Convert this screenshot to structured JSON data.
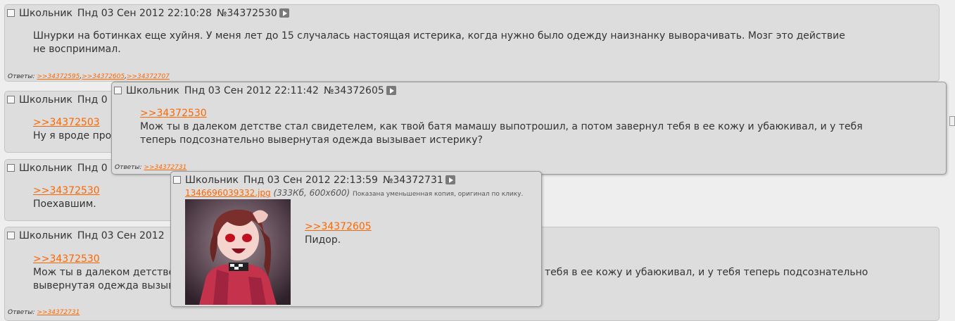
{
  "posts": [
    {
      "name": "Школьник",
      "date": "Пнд 03 Сен 2012 22:10:28",
      "num": "№34372530",
      "text": "Шнурки на ботинках еще хуйня. У меня лет до 15 случалась настоящая истерика, когда нужно было одежду наизнанку выворачивать. Мозг это действие не воспринимал.",
      "replies_label": "Ответы:",
      "replies": [
        ">>34372595",
        ">>34372605",
        ">>34372707"
      ]
    },
    {
      "name": "Школьник",
      "date": "Пнд 0",
      "ref": ">>34372503",
      "text": "Ну я вроде про"
    },
    {
      "name": "Школьник",
      "date": "Пнд 0",
      "ref": ">>34372530",
      "text": "Поехавшим."
    },
    {
      "name": "Школьник",
      "date": "Пнд 03 Сен 2012",
      "ref": ">>34372530",
      "text_line1_left": "Мож ты в далеком детстве",
      "text_line1_right": "тебя в ее кожу и убаюкивал, и у тебя теперь подсознательно",
      "text_line2": "вывернутая одежда вызыва",
      "replies_label": "Ответы:",
      "replies": [
        ">>34372731"
      ]
    }
  ],
  "popups": [
    {
      "name": "Школьник",
      "date": "Пнд 03 Сен 2012 22:11:42",
      "num": "№34372605",
      "ref": ">>34372530",
      "text": "Мож ты в далеком детстве стал свидетелем, как твой батя мамашу выпотрошил, а потом завернул тебя в ее кожу и убаюкивал, и у тебя теперь подсознательно вывернутая одежда вызывает истерику?",
      "replies_label": "Ответы:",
      "replies": [
        ">>34372731"
      ]
    },
    {
      "name": "Школьник",
      "date": "Пнд 03 Сен 2012 22:13:59",
      "num": "№34372731",
      "file_name": "1346696039332.jpg",
      "file_meta": "(333Кб, 600x600)",
      "file_note": "Показана уменьшенная копия, оригинал по клику.",
      "ref": ">>34372605",
      "text": "Пидор."
    }
  ],
  "colors": {
    "link": "#ff6600",
    "post_bg": "#dddddd",
    "page_bg": "#eeeeee"
  }
}
